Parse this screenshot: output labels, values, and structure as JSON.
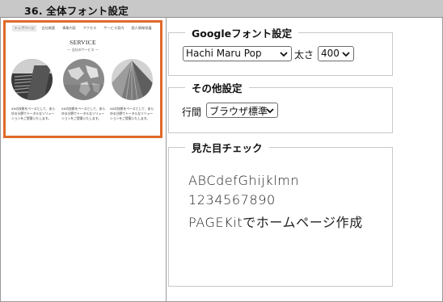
{
  "header": {
    "title": "36. 全体フォント設定"
  },
  "preview": {
    "nav": [
      "トップページ",
      "会社概要",
      "事業内容",
      "アクセス",
      "サービス案内",
      "個人情報保護"
    ],
    "section_title": "SERVICE",
    "section_sub": "— 当社のサービス —",
    "descriptions": [
      "XXの技術をベースとして、あらゆる分野でトータルなソリューションをご提案いたします。",
      "XXの技術をベースとして、あらゆる分野でトータルなソリューションをご提案いたします。",
      "XXの技術をベースとして、あらゆる分野でトータルなソリューションをご提案いたします。"
    ]
  },
  "google_font": {
    "legend": "Googleフォント設定",
    "font_value": "Hachi Maru Pop",
    "size_label": "太さ",
    "size_value": "400"
  },
  "other": {
    "legend": "その他設定",
    "line_label": "行間",
    "line_value": "ブラウザ標準"
  },
  "check": {
    "legend": "見た目チェック",
    "lines": [
      "ABCdefGhijklmn",
      "1234567890",
      "PAGEKitでホームページ作成"
    ]
  },
  "colors": {
    "accent": "#e06a2a",
    "header_bg": "#c8c8c8"
  }
}
